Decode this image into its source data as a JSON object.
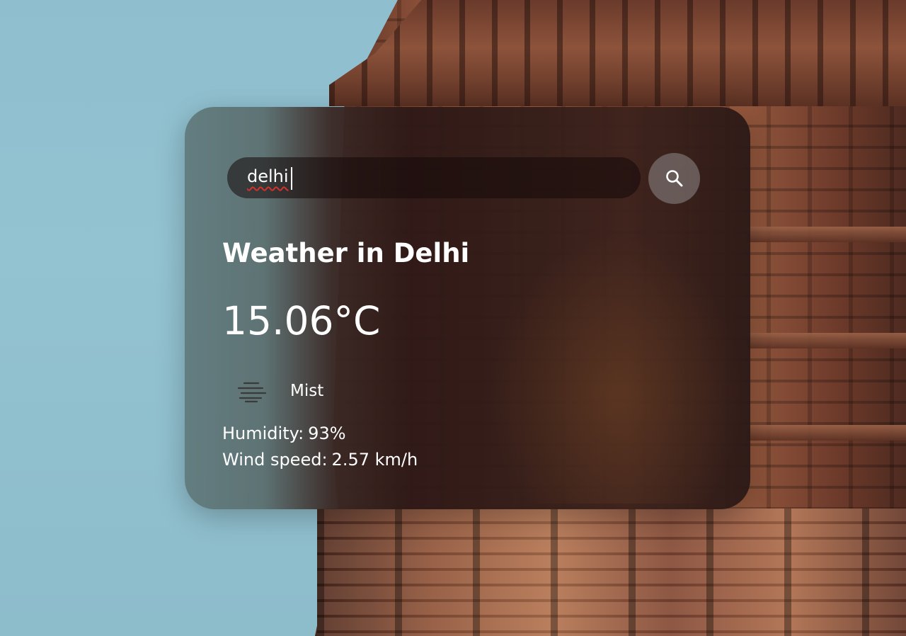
{
  "search": {
    "value": "delhi",
    "button_icon": "search-icon"
  },
  "weather": {
    "title": "Weather in Delhi",
    "temperature": "15.06°C",
    "condition": {
      "icon": "mist-icon",
      "label": "Mist"
    },
    "humidity": {
      "label": "Humidity:",
      "value": "93%"
    },
    "wind": {
      "label": "Wind speed:",
      "value": "2.57 km/h"
    }
  },
  "colors": {
    "text": "#ffffff",
    "spellcheck_underline": "#d2322d",
    "sky": "#8fbfcf"
  }
}
